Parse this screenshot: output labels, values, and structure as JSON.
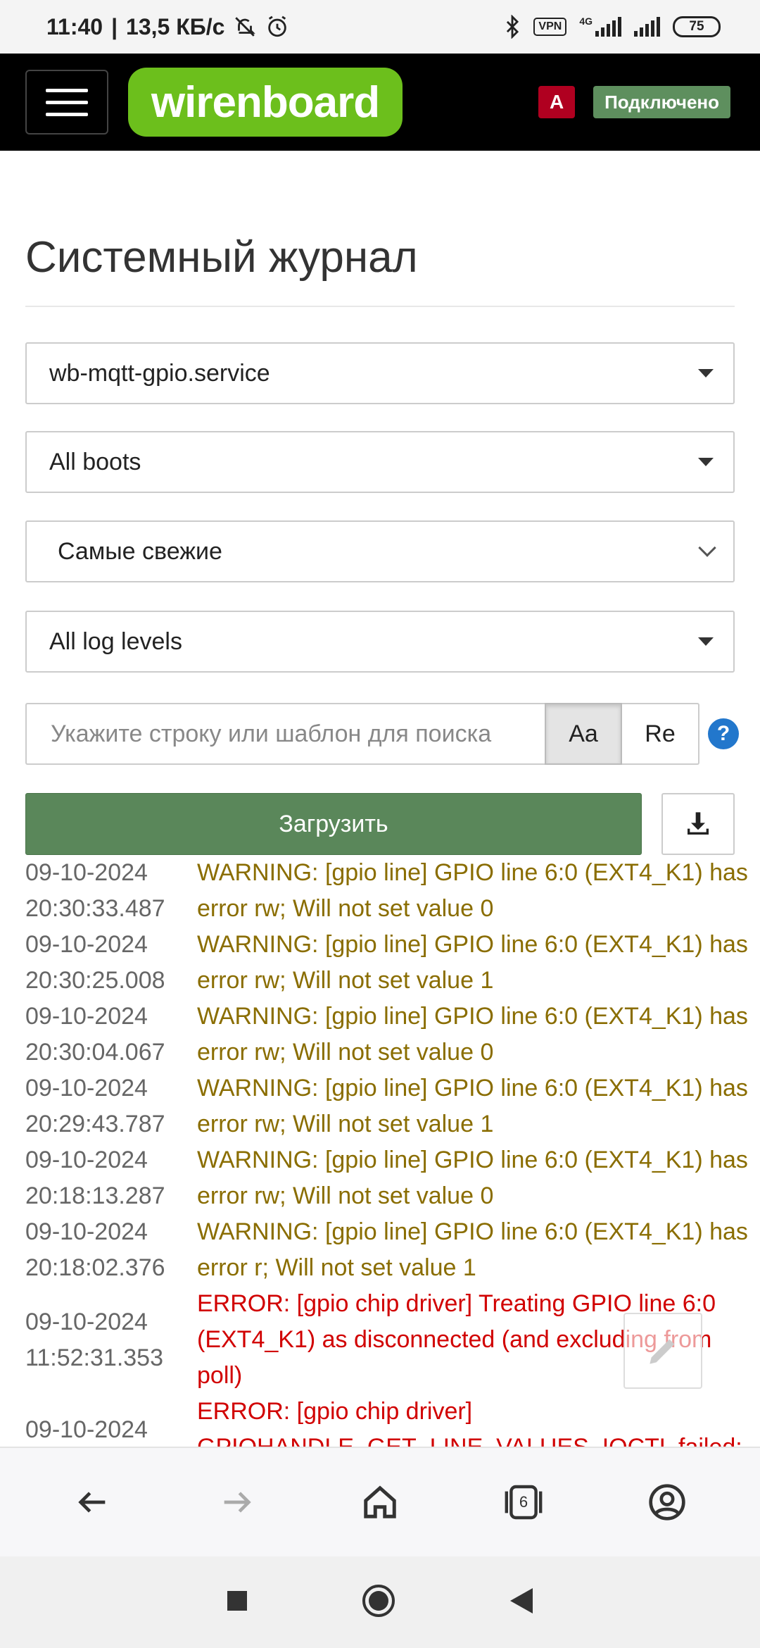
{
  "status_bar": {
    "time": "11:40",
    "speed": "13,5 КБ/с",
    "vpn": "VPN",
    "network": "4G",
    "battery": "75"
  },
  "header": {
    "logo_text": "wirenboard",
    "badge_a": "A",
    "connection_status": "Подключено",
    "colors": {
      "logo": "#6cbf1c",
      "badge_a": "#b00020",
      "connected": "#5e8f5e"
    }
  },
  "page": {
    "title": "Системный журнал"
  },
  "filters": {
    "service": "wb-mqtt-gpio.service",
    "boots": "All boots",
    "order": "Самые свежие",
    "log_level": "All log levels"
  },
  "search": {
    "placeholder": "Укажите строку или шаблон для поиска",
    "case_button": "Aa",
    "regex_button": "Re",
    "help": "?"
  },
  "actions": {
    "load_label": "Загрузить"
  },
  "log": [
    {
      "date": "09-10-2024",
      "time": "20:30:33.487",
      "level": "warn",
      "message": "WARNING: [gpio line] GPIO line 6:0 (EXT4_K1) has error rw; Will not set value 0"
    },
    {
      "date": "09-10-2024",
      "time": "20:30:25.008",
      "level": "warn",
      "message": "WARNING: [gpio line] GPIO line 6:0 (EXT4_K1) has error rw; Will not set value 1"
    },
    {
      "date": "09-10-2024",
      "time": "20:30:04.067",
      "level": "warn",
      "message": "WARNING: [gpio line] GPIO line 6:0 (EXT4_K1) has error rw; Will not set value 0"
    },
    {
      "date": "09-10-2024",
      "time": "20:29:43.787",
      "level": "warn",
      "message": "WARNING: [gpio line] GPIO line 6:0 (EXT4_K1) has error rw; Will not set value 1"
    },
    {
      "date": "09-10-2024",
      "time": "20:18:13.287",
      "level": "warn",
      "message": "WARNING: [gpio line] GPIO line 6:0 (EXT4_K1) has error rw; Will not set value 0"
    },
    {
      "date": "09-10-2024",
      "time": "20:18:02.376",
      "level": "warn",
      "message": "WARNING: [gpio line] GPIO line 6:0 (EXT4_K1) has error r; Will not set value 1"
    },
    {
      "date": "09-10-2024",
      "time": "11:52:31.353",
      "level": "err",
      "message": "ERROR: [gpio chip driver] Treating GPIO line 6:0 (EXT4_K1) as disconnected (and excluding from poll)"
    },
    {
      "date": "09-10-2024",
      "time": "",
      "level": "err",
      "message": "ERROR: [gpio chip driver] GPIOHANDLE_GET_LINE_VALUES_IOCTL failed:"
    }
  ],
  "browser_bar": {
    "tab_count": "6"
  }
}
